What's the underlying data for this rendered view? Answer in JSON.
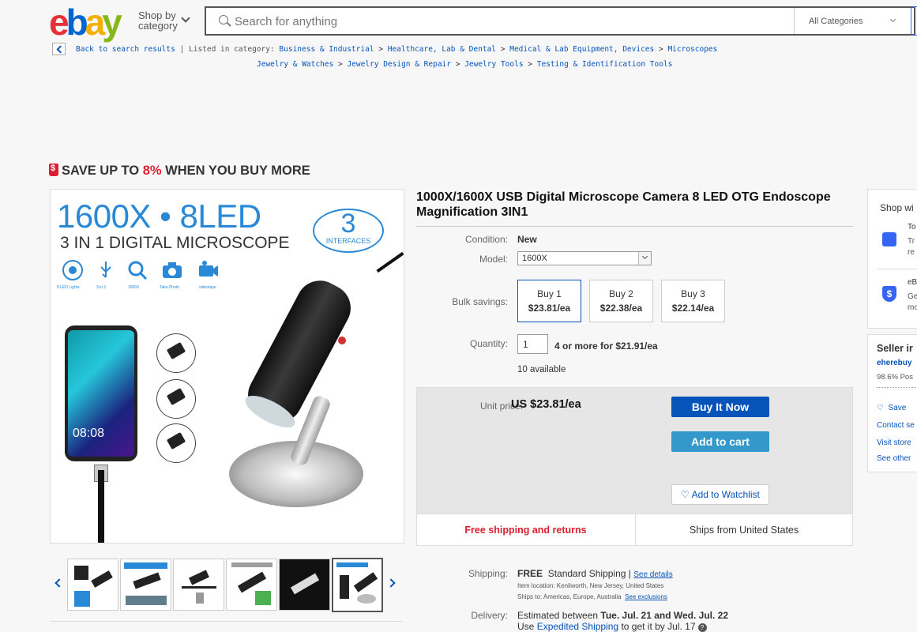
{
  "header": {
    "logo": {
      "e": "e",
      "b": "b",
      "a": "a",
      "y": "y"
    },
    "shop_by_line1": "Shop by",
    "shop_by_line2": "category",
    "search_placeholder": "Search for anything",
    "category_select": "All Categories"
  },
  "breadcrumb": {
    "back": "Back to search results",
    "listed_in": "| Listed in category:",
    "row1": [
      "Business & Industrial",
      "Healthcare, Lab & Dental",
      "Medical & Lab Equipment, Devices",
      "Microscopes"
    ],
    "row2": [
      "Jewelry & Watches",
      "Jewelry Design & Repair",
      "Jewelry Tools",
      "Testing & Identification Tools"
    ],
    "sep": ">"
  },
  "banner": {
    "prefix": "SAVE UP TO ",
    "percent": "8%",
    "suffix": " WHEN YOU BUY MORE"
  },
  "product_image": {
    "headline": "1600X • 8LED",
    "subheadline": "3 IN 1 DIGITAL MICROSCOPE",
    "badge_number": "3",
    "badge_text": "INTERFACES",
    "icon_captions": [
      "8 LED Lights",
      "3 in 1",
      "1600X",
      "Take Photo",
      "videotape"
    ],
    "phone_time": "08:08",
    "thumb_count": 6,
    "selected_thumb": 6
  },
  "product": {
    "title": "1000X/1600X USB Digital Microscope Camera 8 LED OTG Endoscope Magnification 3IN1",
    "condition_label": "Condition:",
    "condition": "New",
    "model_label": "Model:",
    "model": "1600X",
    "bulk_label": "Bulk savings:",
    "bulk": [
      {
        "label": "Buy 1",
        "price": "$23.81/ea"
      },
      {
        "label": "Buy 2",
        "price": "$22.38/ea"
      },
      {
        "label": "Buy 3",
        "price": "$22.14/ea"
      }
    ],
    "quantity_label": "Quantity:",
    "quantity": "1",
    "quantity_deal": "4 or more for $21.91/ea",
    "available": "10 available",
    "unit_price_label": "Unit price:",
    "unit_price": "US $23.81/ea",
    "buy_now": "Buy It Now",
    "add_to_cart": "Add to cart",
    "add_to_watchlist": "Add to Watchlist",
    "free_shipping": "Free shipping and returns",
    "ships_from": "Ships from United States"
  },
  "shipping": {
    "label": "Shipping:",
    "free": "FREE",
    "method": "Standard Shipping |",
    "see_details": "See details",
    "location": "Item location:  Kenilworth, New Jersey, United States",
    "ships_to": "Ships to:  Americas, Europe, Australia",
    "see_exclusions": "See exclusions",
    "delivery_label": "Delivery:",
    "delivery_prefix": "Estimated between ",
    "delivery_dates": "Tue. Jul. 21 and Wed. Jul. 22",
    "expedited_prefix": "Use ",
    "expedited_link": "Expedited Shipping",
    "expedited_suffix": " to get it by Jul. 17"
  },
  "side": {
    "shop_with": "Shop wi",
    "item1_title": "To",
    "item1_l1": "Tr",
    "item1_l2": "re",
    "item2_title": "eB",
    "item2_l1": "Ge",
    "item2_l2": "mo",
    "seller_title": "Seller ir",
    "seller_name": "eherebuy",
    "seller_feedback": "98.6% Pos",
    "save": "Save",
    "contact": "Contact se",
    "visit": "Visit store",
    "see_other": "See other"
  },
  "colors": {
    "ebay_red": "#e53238",
    "ebay_blue": "#0064d2",
    "ebay_yellow": "#f5af02",
    "ebay_green": "#86b817",
    "link": "#0654ba",
    "accent_red": "#dd1e31"
  }
}
